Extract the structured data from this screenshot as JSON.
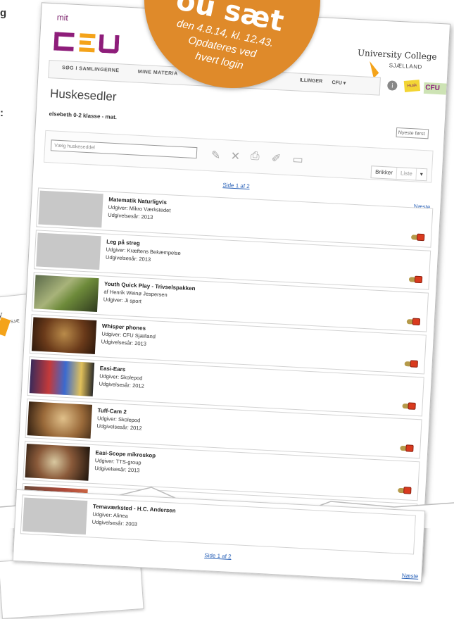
{
  "edge_text": [
    "g",
    ":"
  ],
  "badge": {
    "big": "ou sæt",
    "line1": "den 4.8.14, kl. 12.43.",
    "line2": "Opdateres ved",
    "line3": "hvert login"
  },
  "header": {
    "mit": "mit",
    "university": "University College",
    "sjaelland": "SJÆLLAND"
  },
  "nav": {
    "tabs": [
      "SØG I SAMLINGERNE",
      "MINE MATERIA"
    ],
    "right": [
      "ILLINGER",
      "CFU ▾"
    ],
    "note_icon": "Husk"
  },
  "title": "Huskesedler",
  "subject": "elsebeth 0-2 klasse - mat.",
  "sort": "Nyeste først",
  "toolbar": {
    "select_placeholder": "Vælg huskeseddel",
    "icons": [
      "pencil-icon",
      "close-icon",
      "print-icon",
      "share-icon",
      "export-icon"
    ],
    "view_brikker": "Brikker",
    "view_liste": "Liste"
  },
  "pager_top": "Side 1 af 2",
  "next": "Næste",
  "items": [
    {
      "title": "Matematik Naturligvis",
      "line1": "Udgiver: Mikro Værkstedet",
      "line2": "Udgivelsesår: 2013",
      "thumb": "blank"
    },
    {
      "title": "Leg på streg",
      "line1": "Udgiver: Kræftens Bekæmpelse",
      "line2": "Udgivelsesår: 2013",
      "thumb": "blank"
    },
    {
      "title": "Youth Quick Play - Trivselspakken",
      "line1": "af Henrik Weinø Jespersen",
      "line2": "Udgiver: Ji sport",
      "thumb": "photo1"
    },
    {
      "title": "Whisper phones",
      "line1": "Udgiver: CFU Sjælland",
      "line2": "Udgivelsesår: 2013",
      "thumb": "photo2"
    },
    {
      "title": "Easi-Ears",
      "line1": "Udgiver: Skolepod",
      "line2": "Udgivelsesår: 2012",
      "thumb": "photo3"
    },
    {
      "title": "Tuff-Cam 2",
      "line1": "Udgiver: Skolepod",
      "line2": "Udgivelsesår: 2012",
      "thumb": "photo4"
    },
    {
      "title": "Easi-Scope mikroskop",
      "line1": "Udgiver: TTS-group",
      "line2": "Udgivelsesår: 2013",
      "thumb": "photo5"
    }
  ],
  "last_item": {
    "title": "Temaværksted - H.C. Andersen",
    "line1": "Udgiver: Alinea",
    "line2": "Udgivelsesår: 2003"
  },
  "pager_bottom": "Side 1 af 2",
  "next_bottom": "Næste",
  "bg_sheet_text": [
    "sity",
    "SJÆ"
  ]
}
